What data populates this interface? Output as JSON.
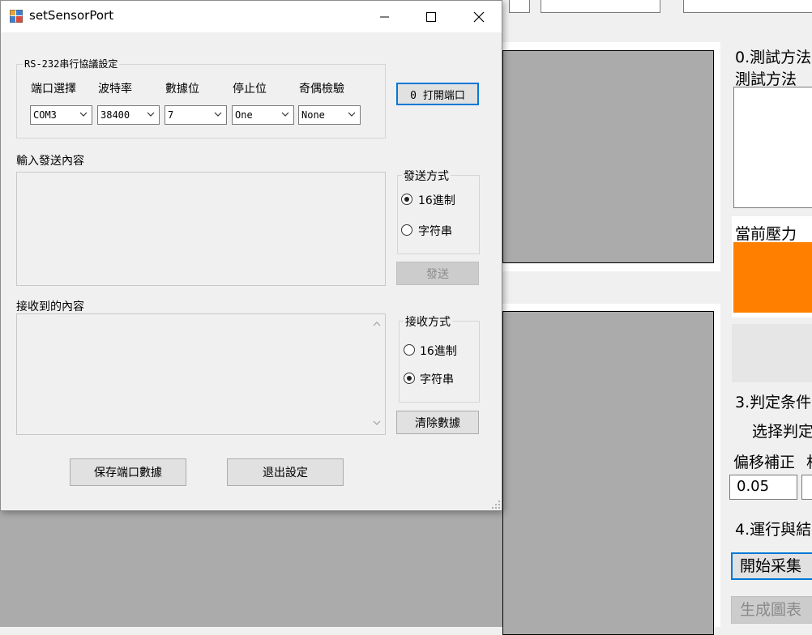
{
  "background_app": {
    "panel0_title": "0.測試方法",
    "panel0_sub": "測試方法",
    "pressure_label": "當前壓力",
    "panel3_title": "3.判定条件",
    "panel3_sub": "选择判定",
    "offset_label": "偏移補正",
    "offset_label_cut": "相",
    "offset_value": "0.05",
    "panel4_title": "4.運行與結",
    "start_button": "開始采集",
    "chart_button": "生成圖表",
    "orange_color": "#ff8000"
  },
  "dialog": {
    "title": "setSensorPort",
    "rs232_group": "RS-232串行協議設定",
    "headers": {
      "port": "端口選擇",
      "baud": "波特率",
      "databits": "數據位",
      "stopbits": "停止位",
      "parity": "奇偶檢驗"
    },
    "values": {
      "port": "COM3",
      "baud": "38400",
      "databits": "7",
      "stopbits": "One",
      "parity": "None"
    },
    "open_port_button": "0  打開端口",
    "send_label": "輸入發送內容",
    "send_mode_group": "發送方式",
    "send_radio_hex": "16進制",
    "send_radio_str": "字符串",
    "send_button": "發送",
    "recv_label": "接收到的內容",
    "recv_mode_group": "接收方式",
    "recv_radio_hex": "16進制",
    "recv_radio_str": "字符串",
    "clear_button": "清除數據",
    "save_button": "保存端口數據",
    "exit_button": "退出設定"
  }
}
